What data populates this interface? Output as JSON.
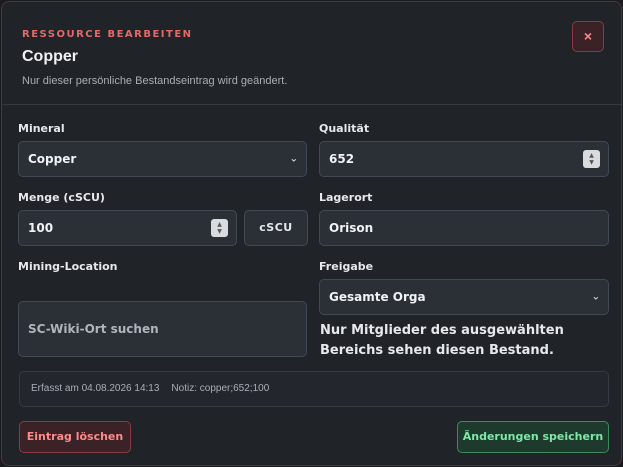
{
  "header": {
    "eyebrow": "RESSOURCE BEARBEITEN",
    "title": "Copper",
    "subtitle": "Nur dieser persönliche Bestandseintrag wird geändert.",
    "close_label": "×"
  },
  "form": {
    "mineral": {
      "label": "Mineral",
      "value": "Copper"
    },
    "quality": {
      "label": "Qualität",
      "value": "652"
    },
    "amount": {
      "label": "Menge (cSCU)",
      "value": "100",
      "unit": "cSCU"
    },
    "storage": {
      "label": "Lagerort",
      "value": "Orison"
    },
    "mining_location": {
      "label": "Mining-Location",
      "placeholder": "SC-Wiki-Ort suchen"
    },
    "release": {
      "label": "Freigabe",
      "value": "Gesamte Orga",
      "hint": "Nur Mitglieder des ausgewählten Bereichs sehen diesen Bestand."
    }
  },
  "info": {
    "recorded": "Erfasst am 04.08.2026 14:13",
    "note": "Notiz: copper;652;100"
  },
  "actions": {
    "delete_label": "Eintrag löschen",
    "save_label": "Änderungen speichern"
  },
  "colors": {
    "accent_red": "#e26a6a",
    "accent_green": "#7ee8a8",
    "background": "#202328"
  }
}
